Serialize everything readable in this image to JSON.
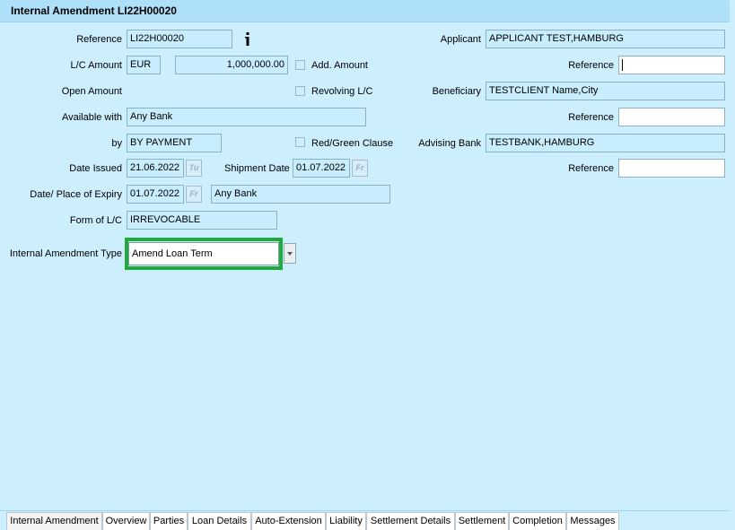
{
  "window": {
    "title": "Internal Amendment LI22H00020"
  },
  "left": {
    "reference_label": "Reference",
    "reference_value": "LI22H00020",
    "lc_amount_label": "L/C Amount",
    "currency": "EUR",
    "amount": "1,000,000.00",
    "add_amount_label": "Add. Amount",
    "open_amount_label": "Open Amount",
    "revolving_label": "Revolving L/C",
    "available_with_label": "Available with",
    "available_with_value": "Any Bank",
    "by_label": "by",
    "by_value": "BY PAYMENT",
    "red_green_label": "Red/Green Clause",
    "date_issued_label": "Date Issued",
    "date_issued_value": "21.06.2022",
    "date_issued_day": "Tu",
    "shipment_date_label": "Shipment Date",
    "shipment_date_value": "01.07.2022",
    "shipment_date_day": "Fr",
    "expiry_label": "Date/ Place of Expiry",
    "expiry_date_value": "01.07.2022",
    "expiry_date_day": "Fr",
    "expiry_place_value": "Any Bank",
    "form_label": "Form of L/C",
    "form_value": "IRREVOCABLE",
    "amend_type_label": "Internal Amendment Type",
    "amend_type_value": "Amend Loan Term"
  },
  "right": {
    "applicant_label": "Applicant",
    "applicant_value": "APPLICANT TEST,HAMBURG",
    "applicant_ref_label": "Reference",
    "applicant_ref_value": "",
    "beneficiary_label": "Beneficiary",
    "beneficiary_value": "TESTCLIENT Name,City",
    "beneficiary_ref_label": "Reference",
    "beneficiary_ref_value": "",
    "advising_label": "Advising Bank",
    "advising_value": "TESTBANK,HAMBURG",
    "advising_ref_label": "Reference",
    "advising_ref_value": ""
  },
  "tabs": [
    {
      "label": "Internal Amendment",
      "active": true
    },
    {
      "label": "Overview"
    },
    {
      "label": "Parties"
    },
    {
      "label": "Loan Details"
    },
    {
      "label": "Auto-Extension"
    },
    {
      "label": "Liability"
    },
    {
      "label": "Settlement Details"
    },
    {
      "label": "Settlement"
    },
    {
      "label": "Completion"
    },
    {
      "label": "Messages"
    }
  ],
  "colors": {
    "background": "#cdeefd",
    "title_bar": "#aee0fa",
    "highlight": "#1faa3a"
  },
  "icons": {
    "info": "info-icon",
    "calendar": "calendar-icon",
    "dropdown": "chevron-down-icon"
  }
}
